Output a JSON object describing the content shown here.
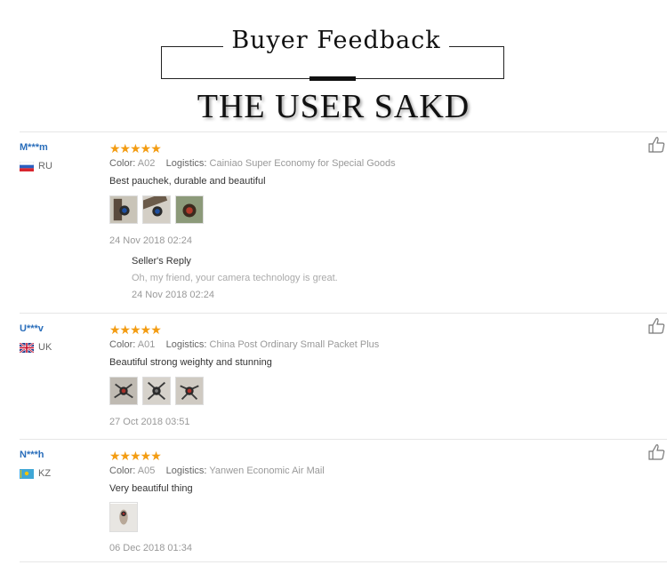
{
  "header": {
    "title": "Buyer Feedback",
    "subtitle": "THE USER SAKD"
  },
  "reviews": [
    {
      "user": "M***m",
      "country": "RU",
      "rating": "★★★★★",
      "color_label": "Color:",
      "color_value": "A02",
      "logistics_label": "Logistics:",
      "logistics_value": "Cainiao Super Economy for Special Goods",
      "comment": "Best pauchek, durable and beautiful",
      "photo_count": 3,
      "date": "24 Nov 2018 02:24",
      "reply": {
        "title": "Seller's Reply",
        "text": "Oh, my friend, your camera technology is great.",
        "date": "24 Nov 2018 02:24"
      }
    },
    {
      "user": "U***v",
      "country": "UK",
      "rating": "★★★★★",
      "color_label": "Color:",
      "color_value": "A01",
      "logistics_label": "Logistics:",
      "logistics_value": "China Post Ordinary Small Packet Plus",
      "comment": "Beautiful strong weighty and stunning",
      "photo_count": 3,
      "date": "27 Oct 2018 03:51"
    },
    {
      "user": "N***h",
      "country": "KZ",
      "rating": "★★★★★",
      "color_label": "Color:",
      "color_value": "A05",
      "logistics_label": "Logistics:",
      "logistics_value": "Yanwen Economic Air Mail",
      "comment": "Very beautiful thing",
      "photo_count": 1,
      "date": "06 Dec 2018 01:34"
    }
  ],
  "icons": {
    "like": "thumbs-up-icon"
  },
  "colors": {
    "star": "#f39c12",
    "username": "#2a6ebb"
  }
}
